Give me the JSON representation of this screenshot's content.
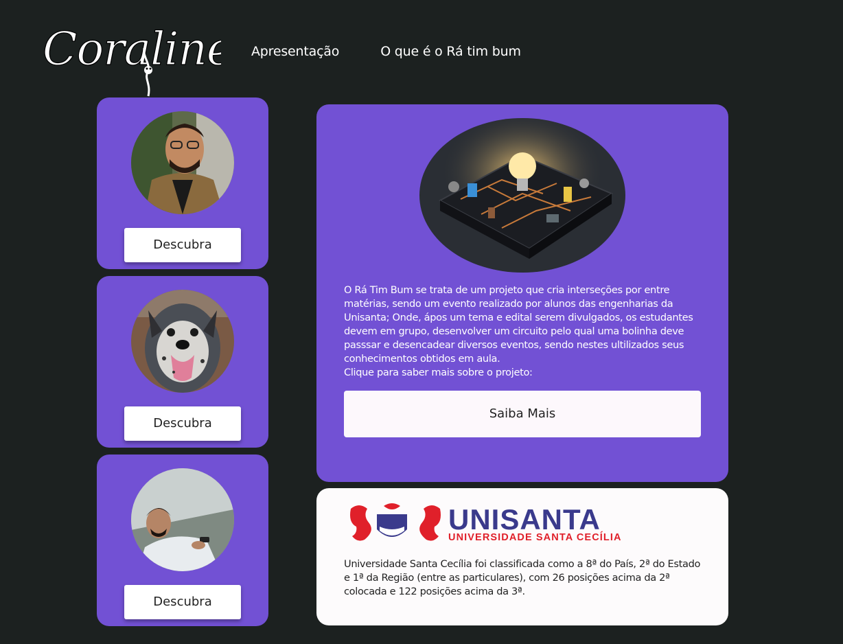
{
  "header": {
    "logo_text": "Coraline",
    "nav": [
      {
        "label": "Apresentação"
      },
      {
        "label": "O que é o Rá tim bum"
      }
    ]
  },
  "profiles": [
    {
      "button_label": "Descubra",
      "photo": "young-man-with-glasses-portrait"
    },
    {
      "button_label": "Descubra",
      "photo": "smiling-dog-portrait"
    },
    {
      "button_label": "Descubra",
      "photo": "man-sitting-with-phone-portrait"
    }
  ],
  "project": {
    "image": "circuit-board-lightbulb-illustration",
    "description": "O Rá Tim Bum se trata de um projeto que cria interseções por entre matérias, sendo um evento realizado por alunos das engenharias da Unisanta; Onde, ápos um tema e edital serem divulgados, os estudantes devem em grupo, desenvolver um circuito pelo qual uma bolinha deve passsar e desencadear diversos eventos, sendo nestes ultilizados seus conhecimentos obtidos em aula.",
    "call_to_action": "Clique para saber mais sobre o projeto:",
    "button_label": "Saiba Mais"
  },
  "university": {
    "logo_name": "UNISANTA",
    "logo_subtitle": "UNIVERSIDADE SANTA CECÍLIA",
    "description": "Universidade Santa Cecília foi classificada como a 8ª do País, 2ª do Estado e 1ª da Região (entre as particulares), com 26 posições acima da 2ª colocada e 122 posições acima da 3ª."
  },
  "colors": {
    "background": "#1c2120",
    "card_purple": "#7251d4",
    "unisanta_blue": "#3a3a8c",
    "unisanta_red": "#e0202a"
  }
}
